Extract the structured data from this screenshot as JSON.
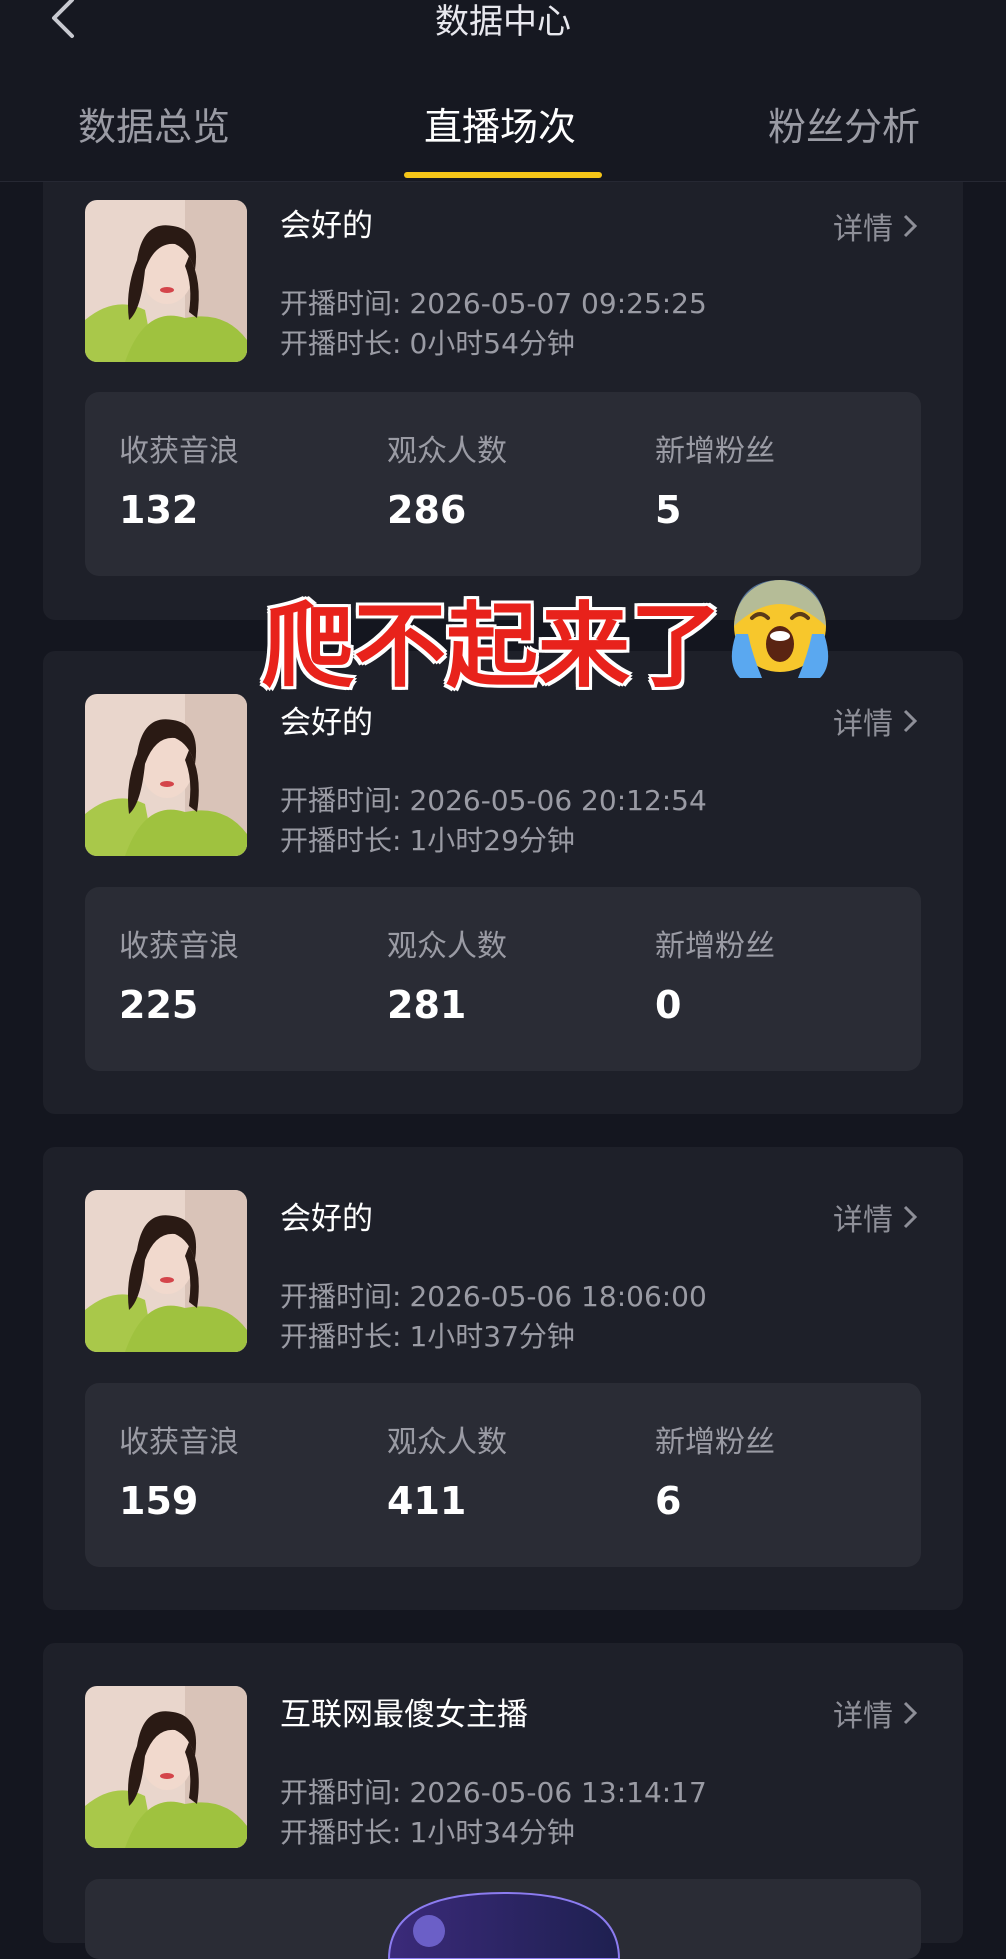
{
  "header": {
    "title": "数据中心"
  },
  "tabs": [
    {
      "label": "数据总览",
      "active": false
    },
    {
      "label": "直播场次",
      "active": true
    },
    {
      "label": "粉丝分析",
      "active": false
    }
  ],
  "labels": {
    "detail": "详情",
    "start_time": "开播时间:",
    "duration": "开播时长:",
    "stat_income": "收获音浪",
    "stat_viewers": "观众人数",
    "stat_fans": "新增粉丝"
  },
  "sessions": [
    {
      "title": "会好的",
      "start_time": "2026-05-07 09:25:25",
      "duration": "0小时54分钟",
      "income": "132",
      "viewers": "286",
      "fans": "5"
    },
    {
      "title": "会好的",
      "start_time": "2026-05-06 20:12:54",
      "duration": "1小时29分钟",
      "income": "225",
      "viewers": "281",
      "fans": "0"
    },
    {
      "title": "会好的",
      "start_time": "2026-05-06 18:06:00",
      "duration": "1小时37分钟",
      "income": "159",
      "viewers": "411",
      "fans": "6"
    },
    {
      "title": "互联网最傻女主播",
      "start_time": "2026-05-06 13:14:17",
      "duration": "1小时34分钟"
    }
  ],
  "overlay": {
    "text": "爬不起来了",
    "emoji": "crying-face-emoji"
  },
  "colors": {
    "accent": "#f5c518",
    "overlay_text": "#e8221b"
  }
}
